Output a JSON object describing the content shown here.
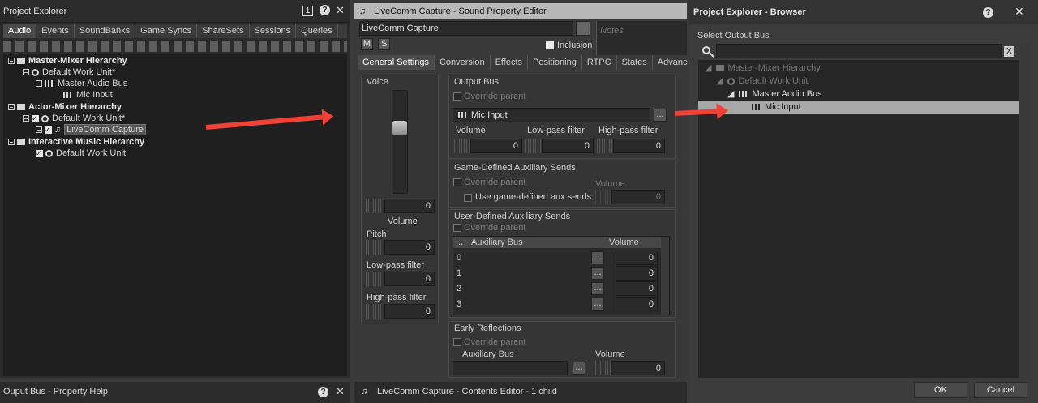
{
  "project_explorer": {
    "title": "Project Explorer",
    "badge": "1",
    "tabs": [
      "Audio",
      "Events",
      "SoundBanks",
      "Game Syncs",
      "ShareSets",
      "Sessions",
      "Queries"
    ],
    "tree": [
      {
        "label": "Master-Mixer Hierarchy"
      },
      {
        "label": "Default Work Unit*"
      },
      {
        "label": "Master Audio Bus"
      },
      {
        "label": "Mic Input"
      },
      {
        "label": "Actor-Mixer Hierarchy"
      },
      {
        "label": "Default Work Unit*"
      },
      {
        "label": "LiveComm Capture"
      },
      {
        "label": "Interactive Music Hierarchy"
      },
      {
        "label": "Default Work Unit"
      }
    ]
  },
  "property_help": {
    "title": "Ouput Bus - Property Help"
  },
  "editor": {
    "title": "LiveComm Capture - Sound Property Editor",
    "name_value": "LiveComm Capture",
    "mute": "M",
    "solo": "S",
    "inclusion": "Inclusion",
    "notes_placeholder": "Notes",
    "tabs": [
      "General Settings",
      "Conversion",
      "Effects",
      "Positioning",
      "RTPC",
      "States",
      "Advanced Setti"
    ],
    "voice_label": "Voice",
    "voice_value": "0",
    "volume_label": "Volume",
    "pitch_label": "Pitch",
    "pitch_value": "0",
    "lpf_label": "Low-pass filter",
    "lpf_value": "0",
    "hpf_label": "High-pass filter",
    "hpf_value": "0",
    "output_bus": {
      "title": "Output Bus",
      "override": "Override parent",
      "bus": "Mic Input",
      "dots": "...",
      "volume_label": "Volume",
      "volume_value": "0",
      "lpf_label": "Low-pass filter",
      "lpf_value": "0",
      "hpf_label": "High-pass filter",
      "hpf_value": "0"
    },
    "game_aux": {
      "title": "Game-Defined Auxiliary Sends",
      "override": "Override parent",
      "use": "Use game-defined aux sends",
      "volume_label": "Volume",
      "volume_value": "0"
    },
    "user_aux": {
      "title": "User-Defined Auxiliary Sends",
      "override": "Override parent",
      "col_index": "I..",
      "col_bus": "Auxiliary Bus",
      "col_volume": "Volume",
      "rows": [
        {
          "index": "0",
          "volume": "0"
        },
        {
          "index": "1",
          "volume": "0"
        },
        {
          "index": "2",
          "volume": "0"
        },
        {
          "index": "3",
          "volume": "0"
        }
      ]
    },
    "early": {
      "title": "Early Reflections",
      "override": "Override parent",
      "aux_label": "Auxiliary Bus",
      "volume_label": "Volume",
      "volume_value": "0"
    }
  },
  "contents_editor": {
    "title": "LiveComm Capture - Contents Editor - 1 child"
  },
  "browser": {
    "title": "Project Explorer - Browser",
    "select_label": "Select Output Bus",
    "clear": "X",
    "tree": [
      {
        "label": "Master-Mixer Hierarchy"
      },
      {
        "label": "Default Work Unit"
      },
      {
        "label": "Master Audio Bus"
      },
      {
        "label": "Mic Input"
      }
    ],
    "ok": "OK",
    "cancel": "Cancel"
  },
  "colors": {
    "arrow": "#ef4135",
    "selection": "#a8a8a8",
    "panel": "#252525"
  }
}
